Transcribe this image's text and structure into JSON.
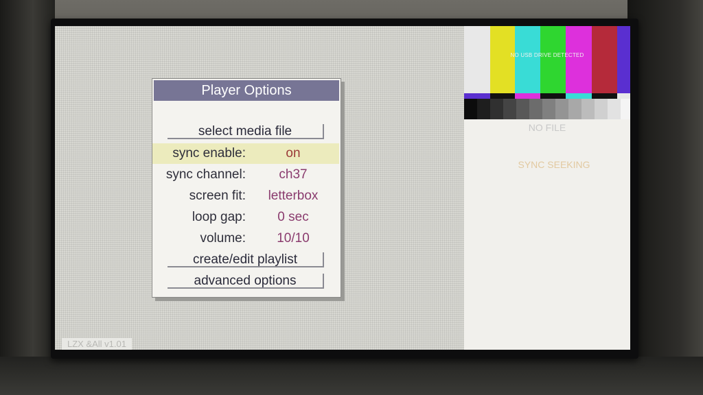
{
  "dialog": {
    "title": "Player Options",
    "select_media": "select media file",
    "options": [
      {
        "label": "sync enable:",
        "value": "on"
      },
      {
        "label": "sync channel:",
        "value": "ch37"
      },
      {
        "label": "screen fit:",
        "value": "letterbox"
      },
      {
        "label": "loop gap:",
        "value": "0 sec"
      },
      {
        "label": "volume:",
        "value": "10/10"
      }
    ],
    "playlist": "create/edit playlist",
    "advanced": "advanced options"
  },
  "version": "LZX &All v1.01",
  "preview": {
    "pattern_message": "NO USB DRIVE DETECTED",
    "status": "NO FILE",
    "sync_status": "SYNC SEEKING"
  },
  "colors": {
    "title_bar": "#777595",
    "highlight_row": "#ecebbd",
    "value_text": "#8a3b6e",
    "bars": [
      "#e8e8e8",
      "#e3e024",
      "#39dcd6",
      "#2fd630",
      "#dd30dc",
      "#b52a3a",
      "#5a2fd0"
    ]
  }
}
